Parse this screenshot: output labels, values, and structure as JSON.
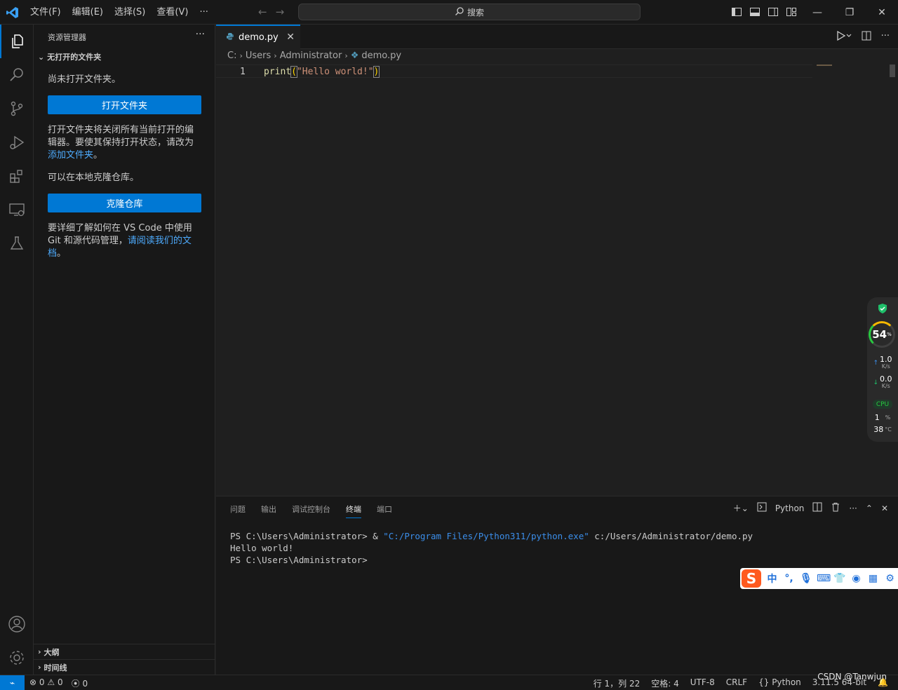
{
  "menu": [
    "文件(F)",
    "编辑(E)",
    "选择(S)",
    "查看(V)",
    "···"
  ],
  "search": {
    "label": "搜索"
  },
  "sidebar": {
    "title": "资源管理器",
    "more": "···",
    "section": "无打开的文件夹",
    "no_folder": "尚未打开文件夹。",
    "open_folder_button": "打开文件夹",
    "open_folder_desc_1": "打开文件夹将关闭所有当前打开的编辑器。要使其保持打开状态，请改为",
    "add_folder_link": "添加文件夹",
    "period": "。",
    "clone_desc": "可以在本地克隆仓库。",
    "clone_button": "克隆仓库",
    "git_desc": "要详细了解如何在 VS Code 中使用 Git 和源代码管理，",
    "read_docs_link": "请阅读我们的文档",
    "outline": "大纲",
    "timeline": "时间线"
  },
  "editor": {
    "tab_name": "demo.py",
    "breadcrumb": [
      "C:",
      "Users",
      "Administrator",
      "demo.py"
    ],
    "line_number": "1",
    "code": {
      "fn": "print",
      "open": "(",
      "str": "\"Hello world!\"",
      "close": ")"
    }
  },
  "panel": {
    "tabs": [
      "问题",
      "输出",
      "调试控制台",
      "终端",
      "端口"
    ],
    "active_tab": "终端",
    "shell_label": "Python",
    "terminal": {
      "line1_prefix": "PS C:\\Users\\Administrator> & ",
      "line1_str": "\"C:/Program Files/Python311/python.exe\"",
      "line1_suffix": " c:/Users/Administrator/demo.py",
      "line2": "Hello world!",
      "line3": "PS C:\\Users\\Administrator>"
    }
  },
  "statusbar": {
    "errors": "0",
    "warnings": "0",
    "ports": "0",
    "position": "行 1，列 22",
    "spaces": "空格: 4",
    "encoding": "UTF-8",
    "eol": "CRLF",
    "language": "Python",
    "interpreter": "3.11.5 64-bit"
  },
  "watermark": "CSDN @Tanwjun",
  "widget": {
    "percent": "54",
    "percent_unit": "%",
    "up": "1.0",
    "down": "0.0",
    "rate_unit": "K/s",
    "cpu_label": "CPU",
    "cpu_value": "1",
    "cpu_unit": "%",
    "temp": "38",
    "temp_unit": "°C"
  },
  "ime": {
    "lang": "中",
    "punct": "°,"
  },
  "colors": {
    "accent": "#0078d4",
    "background": "#1f1f1f",
    "bars": "#181818",
    "link": "#4daafc"
  }
}
